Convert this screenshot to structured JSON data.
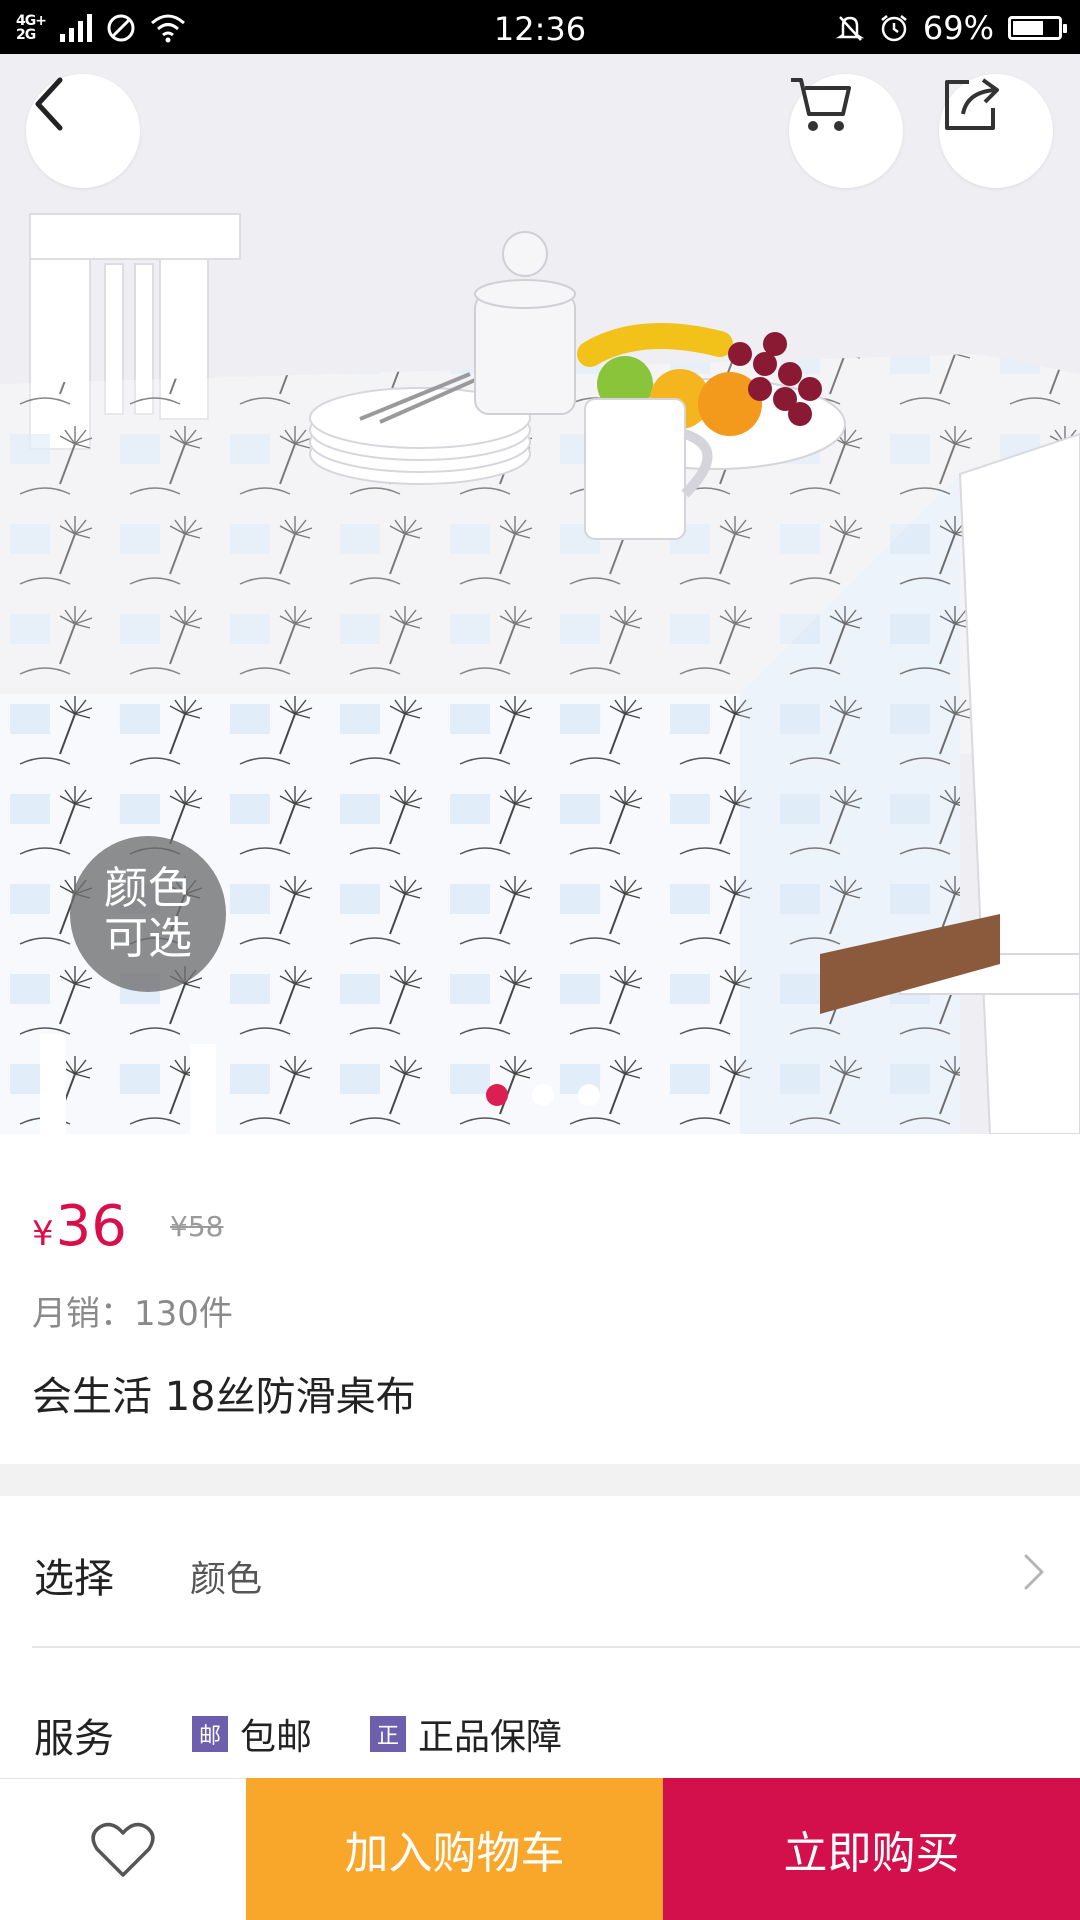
{
  "status_bar": {
    "network": "4G+\n2G",
    "time": "12:36",
    "battery": "69%",
    "battery_level": 0.69
  },
  "hero": {
    "color_badge": "颜色\n可选",
    "carousel_total": 3,
    "carousel_active_index": 0
  },
  "product": {
    "currency": "¥",
    "price": "36",
    "original_price": "¥58",
    "monthly_sales": "月销：130件",
    "title": "会生活 18丝防滑桌布"
  },
  "select": {
    "label": "选择",
    "value": "颜色"
  },
  "service": {
    "label": "服务",
    "items": [
      {
        "tag": "邮",
        "text": "包邮"
      },
      {
        "tag": "正",
        "text": "正品保障"
      }
    ]
  },
  "bottom_bar": {
    "add_to_cart": "加入购物车",
    "buy_now": "立即购买"
  },
  "colors": {
    "accent_price": "#d80f4a",
    "cart_button": "#f8a72a",
    "buy_button": "#d30f4c",
    "service_tag": "#6e5fae"
  },
  "icons": [
    "back-icon",
    "cart-icon",
    "share-icon",
    "heart-icon",
    "chevron-right-icon"
  ]
}
